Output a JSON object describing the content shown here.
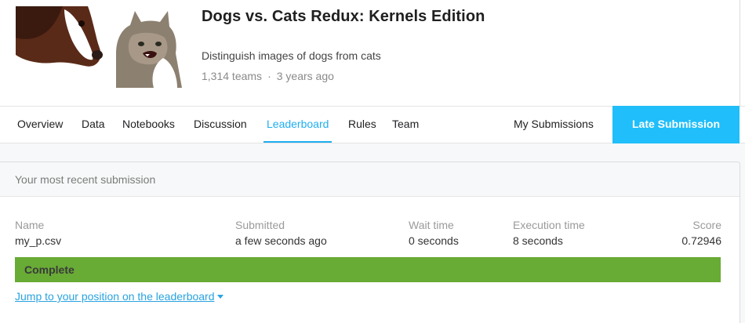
{
  "competition": {
    "title": "Dogs vs. Cats Redux: Kernels Edition",
    "subtitle": "Distinguish images of dogs from cats",
    "teams": "1,314 teams",
    "separator": "·",
    "age": "3 years ago"
  },
  "nav": {
    "tabs": [
      {
        "label": "Overview"
      },
      {
        "label": "Data"
      },
      {
        "label": "Notebooks"
      },
      {
        "label": "Discussion"
      },
      {
        "label": "Leaderboard"
      },
      {
        "label": "Rules"
      },
      {
        "label": "Team"
      }
    ],
    "active_tab": "Leaderboard",
    "my_submissions": "My Submissions",
    "late_submission": "Late Submission"
  },
  "submission": {
    "heading": "Your most recent submission",
    "columns": {
      "name": "Name",
      "submitted": "Submitted",
      "wait_time": "Wait time",
      "execution_time": "Execution time",
      "score": "Score"
    },
    "values": {
      "name": "my_p.csv",
      "submitted": "a few seconds ago",
      "wait_time": "0 seconds",
      "execution_time": "8 seconds",
      "score": "0.72946"
    },
    "status": "Complete",
    "jump_link": "Jump to your position on the leaderboard"
  },
  "colors": {
    "accent": "#20befa",
    "status_complete": "#68ab35",
    "link": "#2aa3e0"
  },
  "icons": {
    "jump_caret": "caret-down-icon"
  }
}
